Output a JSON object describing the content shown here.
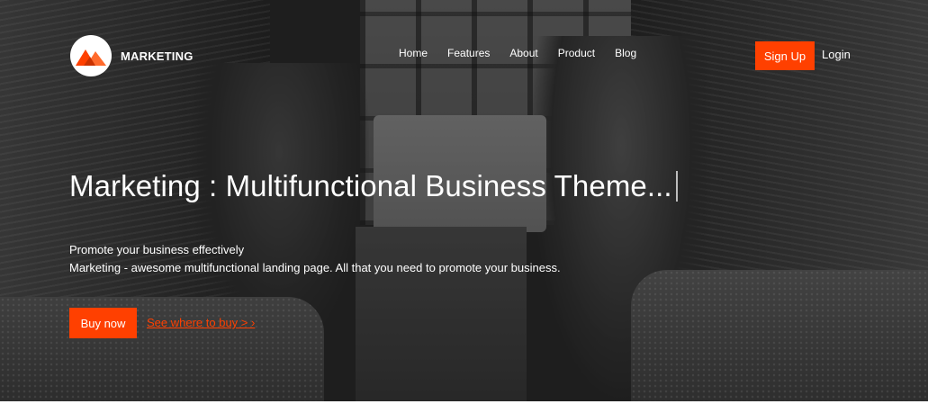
{
  "brand": {
    "name": "MARKETING",
    "logo_icon": "mountain-icon",
    "accent_color": "#ff4000"
  },
  "nav": {
    "items": [
      {
        "label": "Home"
      },
      {
        "label": "Features"
      },
      {
        "label": "About"
      },
      {
        "label": "Product"
      },
      {
        "label": "Blog"
      }
    ],
    "signup_label": "Sign Up",
    "login_label": "Login"
  },
  "hero": {
    "headline": "Marketing : Multifunctional Business Theme...",
    "subtitle_line1": "Promote your business effectively",
    "subtitle_line2": "Marketing - awesome multifunctional landing page. All that you need to promote your business.",
    "buy_label": "Buy now",
    "link_label": "See where to buy >",
    "link_chevron": "›"
  }
}
